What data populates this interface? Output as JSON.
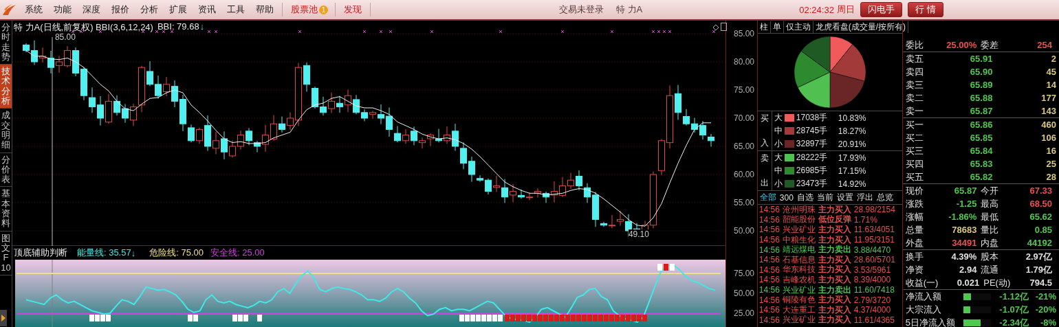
{
  "menu_bar": {
    "items": [
      "系统",
      "功能",
      "深度",
      "报价",
      "分析",
      "扩展",
      "资讯",
      "工具",
      "帮助"
    ],
    "highlight_items": [
      {
        "label": "股票池",
        "badge": "1"
      },
      {
        "label": "发现"
      }
    ],
    "status": "交易未登录",
    "stock": "特 力A",
    "time": "02:24:32",
    "weekday": "周日",
    "buttons": [
      "闪电手",
      "行 情"
    ]
  },
  "side_tabs": [
    {
      "label": "分时走势",
      "selected": false
    },
    {
      "label": "技术分析",
      "selected": true
    },
    {
      "label": "成交明细",
      "selected": false
    },
    {
      "label": "分价表",
      "selected": false
    },
    {
      "label": "基本资料",
      "selected": false
    },
    {
      "label": "图文F10",
      "selected": false
    }
  ],
  "main_chart": {
    "title": "特 力A(日线,前复权) BBI(3,6,12,24)",
    "bbi": "BBI: 79.68",
    "trend_arrow": "↓",
    "high_marker": "85.00",
    "low_marker": "49.10",
    "y_labels": [
      "85.00",
      "80.00",
      "75.00",
      "70.00",
      "65.00",
      "60.00",
      "55.00",
      "50.00"
    ]
  },
  "indicator": {
    "name": "顶底辅助判断",
    "lines": [
      {
        "label": "能量线: 35.57",
        "color": "#40e8e8",
        "arrow": "↓"
      },
      {
        "label": "危险线: 75.00",
        "color": "#f0e080"
      },
      {
        "label": "安全线: 25.00",
        "color": "#d040e0"
      }
    ],
    "y_labels": [
      "75.00",
      "50.00",
      "25.00"
    ]
  },
  "flow_panel": {
    "tabs": [
      "柱",
      "单",
      "仅主动",
      "龙虎看盘(成交量/按所有)"
    ],
    "chart_data": {
      "type": "pie",
      "values": [
        10.83,
        18.27,
        20.91,
        17.93,
        17.15,
        14.92
      ]
    },
    "groups": [
      {
        "label_top": "买",
        "label_bottom": "入",
        "rows": [
          {
            "size": "大",
            "color": "#f05a5a",
            "volume": "17038手",
            "pct": "10.83%"
          },
          {
            "size": "中",
            "color": "#a33a3a",
            "volume": "28745手",
            "pct": "18.27%"
          },
          {
            "size": "小",
            "color": "#6a2626",
            "volume": "32897手",
            "pct": "20.91%"
          }
        ]
      },
      {
        "label_top": "卖",
        "label_bottom": "出",
        "rows": [
          {
            "size": "大",
            "color": "#50c050",
            "volume": "28222手",
            "pct": "17.93%"
          },
          {
            "size": "中",
            "color": "#2e8a2e",
            "volume": "26985手",
            "pct": "17.15%"
          },
          {
            "size": "小",
            "color": "#1f5a24",
            "volume": "23473手",
            "pct": "14.92%"
          }
        ]
      }
    ],
    "news_tabs": [
      {
        "label": "全部",
        "selected": true
      },
      {
        "label": "300",
        "selected": false
      },
      {
        "label": "自选",
        "selected": false
      },
      {
        "label": "当前",
        "selected": false
      },
      {
        "label": "设置",
        "selected": false
      },
      {
        "label": "浮出",
        "selected": false
      },
      {
        "label": "总览",
        "selected": false
      }
    ],
    "news": [
      {
        "time": "14:56",
        "name": "沧州明珠",
        "action": "主力买入",
        "value": "28.98/2154",
        "color": "#e85050"
      },
      {
        "time": "14:56",
        "name": "韶能股份",
        "action": "低位反弹",
        "value": "1.71%",
        "color": "#e85050"
      },
      {
        "time": "14:56",
        "name": "兴业矿业",
        "action": "主力买入",
        "value": "11.63/4051",
        "color": "#e85050"
      },
      {
        "time": "14:56",
        "name": "中粮生化",
        "action": "主力买入",
        "value": "11.95/3151",
        "color": "#e85050"
      },
      {
        "time": "14:56",
        "name": "靖远煤电",
        "action": "主力卖出",
        "value": "3.88/4470",
        "color": "#50c850"
      },
      {
        "time": "14:56",
        "name": "石基信息",
        "action": "主力买入",
        "value": "28.60/5701",
        "color": "#e85050"
      },
      {
        "time": "14:56",
        "name": "华东科技",
        "action": "主力买入",
        "value": "3.53/5961",
        "color": "#e85050"
      },
      {
        "time": "14:56",
        "name": "吉峰农机",
        "action": "主力买入",
        "value": "8.39/4000",
        "color": "#e85050"
      },
      {
        "time": "14:56",
        "name": "兴业矿业",
        "action": "主力卖出",
        "value": "11.60/7418",
        "color": "#50c850"
      },
      {
        "time": "14:56",
        "name": "铜陵有色",
        "action": "主力买入",
        "value": "2.79/3720",
        "color": "#e85050"
      },
      {
        "time": "14:56",
        "name": "大连重工",
        "action": "主力买入",
        "value": "4.37/4000",
        "color": "#e85050"
      },
      {
        "time": "14:56",
        "name": "兴业矿业",
        "action": "主力买入",
        "value": "11.61/4365",
        "color": "#e85050"
      }
    ]
  },
  "quote": {
    "ratio": [
      {
        "label": "委比",
        "value": "25.00%",
        "color": "#e85050"
      },
      {
        "label": "委差",
        "value": "254",
        "color": "#e85050"
      }
    ],
    "asks": [
      {
        "label": "卖五",
        "price": "65.91",
        "qty": "2",
        "color": "#50c850"
      },
      {
        "label": "卖四",
        "price": "65.90",
        "qty": "45",
        "color": "#50c850"
      },
      {
        "label": "卖三",
        "price": "65.89",
        "qty": "14",
        "color": "#50c850"
      },
      {
        "label": "卖二",
        "price": "65.88",
        "qty": "177",
        "color": "#50c850"
      },
      {
        "label": "卖一",
        "price": "65.87",
        "qty": "143",
        "color": "#50c850"
      }
    ],
    "bids": [
      {
        "label": "买一",
        "price": "65.86",
        "qty": "460",
        "color": "#50c850"
      },
      {
        "label": "买二",
        "price": "65.85",
        "qty": "106",
        "color": "#50c850"
      },
      {
        "label": "买三",
        "price": "65.84",
        "qty": "16",
        "color": "#50c850"
      },
      {
        "label": "买四",
        "price": "65.83",
        "qty": "25",
        "color": "#50c850"
      },
      {
        "label": "买五",
        "price": "65.82",
        "qty": "28",
        "color": "#50c850"
      }
    ],
    "stats": [
      [
        {
          "label": "现价",
          "value": "65.87",
          "color": "#50c850"
        },
        {
          "label": "今开",
          "value": "67.33",
          "color": "#e85050"
        }
      ],
      [
        {
          "label": "涨跌",
          "value": "-1.25",
          "color": "#50c850"
        },
        {
          "label": "最高",
          "value": "68.50",
          "color": "#e85050"
        }
      ],
      [
        {
          "label": "涨幅",
          "value": "-1.86%",
          "color": "#50c850"
        },
        {
          "label": "最低",
          "value": "65.62",
          "color": "#50c850"
        }
      ],
      [
        {
          "label": "总量",
          "value": "78683",
          "color": "#d8c880"
        },
        {
          "label": "量比",
          "value": "0.85",
          "color": "#50c850"
        }
      ],
      [
        {
          "label": "外盘",
          "value": "34491",
          "color": "#e85050"
        },
        {
          "label": "内盘",
          "value": "44192",
          "color": "#50c850"
        }
      ]
    ],
    "fundamentals": [
      [
        {
          "label": "换手",
          "value": "4.39%"
        },
        {
          "label": "股本",
          "value": "2.97亿"
        }
      ],
      [
        {
          "label": "净资",
          "value": "2.94"
        },
        {
          "label": "流通",
          "value": "1.79亿"
        }
      ],
      [
        {
          "label": "收益(一)",
          "value": "0.021"
        },
        {
          "label": "PE(动)",
          "value": "794.5"
        }
      ]
    ],
    "flows": [
      {
        "label": "净流入额",
        "level": 0.28,
        "amount": "-1.12亿",
        "pct": "-21%",
        "color": "#50c850"
      },
      {
        "label": "大宗流入",
        "level": 0.25,
        "amount": "-1.07亿",
        "pct": "-20%",
        "color": "#50c850"
      },
      {
        "label": "5日净流入额",
        "level": 0.62,
        "amount": "-2.34亿",
        "pct": "-8%",
        "color": "#50c850"
      }
    ]
  }
}
